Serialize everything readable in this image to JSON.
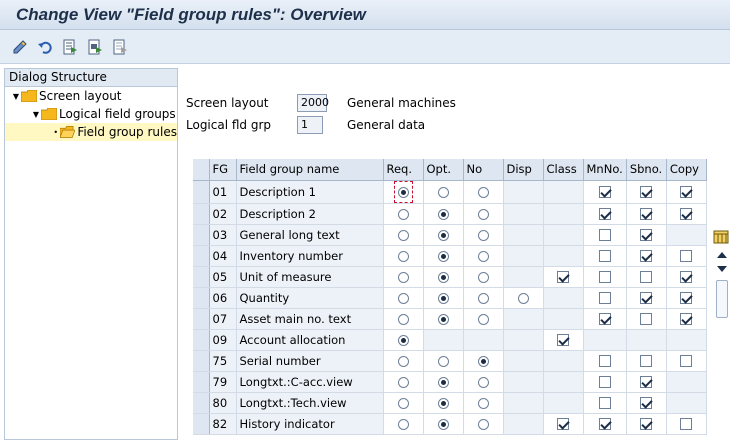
{
  "window": {
    "title": "Change View \"Field group rules\": Overview"
  },
  "toolbar": {
    "buttons": [
      {
        "name": "display-change-icon"
      },
      {
        "name": "undo-icon"
      },
      {
        "name": "select-all-icon"
      },
      {
        "name": "select-block-icon"
      },
      {
        "name": "deselect-all-icon"
      }
    ]
  },
  "dialog_structure": {
    "header": "Dialog Structure",
    "items": [
      {
        "label": "Screen layout",
        "level": 0
      },
      {
        "label": "Logical field groups",
        "level": 1
      },
      {
        "label": "Field group rules",
        "level": 2,
        "selected": true
      }
    ]
  },
  "header_fields": {
    "screen_layout": {
      "label": "Screen layout",
      "value": "2000",
      "desc": "General machines"
    },
    "logical_fld_grp": {
      "label": "Logical fld grp",
      "value": "1",
      "desc": "General data"
    }
  },
  "table": {
    "columns": [
      "FG",
      "Field group name",
      "Req.",
      "Opt.",
      "No",
      "Disp",
      "Class",
      "MnNo.",
      "Sbno.",
      "Copy"
    ],
    "rows": [
      {
        "fg": "01",
        "name": "Description 1",
        "radio": "req",
        "radios": [
          "req",
          "opt",
          "no"
        ],
        "class": null,
        "mnno": true,
        "sbno": true,
        "copy": true,
        "focus": true
      },
      {
        "fg": "02",
        "name": "Description 2",
        "radio": "opt",
        "radios": [
          "req",
          "opt",
          "no"
        ],
        "class": null,
        "mnno": true,
        "sbno": true,
        "copy": true
      },
      {
        "fg": "03",
        "name": "General long text",
        "radio": "opt",
        "radios": [
          "req",
          "opt",
          "no"
        ],
        "class": null,
        "mnno": false,
        "sbno": true,
        "copy": null
      },
      {
        "fg": "04",
        "name": "Inventory number",
        "radio": "opt",
        "radios": [
          "req",
          "opt",
          "no"
        ],
        "class": null,
        "mnno": false,
        "sbno": true,
        "copy": false
      },
      {
        "fg": "05",
        "name": "Unit of measure",
        "radio": "opt",
        "radios": [
          "req",
          "opt",
          "no"
        ],
        "class": true,
        "mnno": false,
        "sbno": false,
        "copy": true
      },
      {
        "fg": "06",
        "name": "Quantity",
        "radio": "opt",
        "radios": [
          "req",
          "opt",
          "no",
          "disp"
        ],
        "class": null,
        "mnno": false,
        "sbno": true,
        "copy": true
      },
      {
        "fg": "07",
        "name": "Asset main no. text",
        "radio": "opt",
        "radios": [
          "req",
          "opt",
          "no"
        ],
        "class": null,
        "mnno": true,
        "sbno": false,
        "copy": true
      },
      {
        "fg": "09",
        "name": "Account allocation",
        "radio": "req",
        "radios": [
          "req"
        ],
        "class": true,
        "mnno": null,
        "sbno": null,
        "copy": null
      },
      {
        "fg": "75",
        "name": "Serial number",
        "radio": "no",
        "radios": [
          "req",
          "opt",
          "no"
        ],
        "class": null,
        "mnno": false,
        "sbno": false,
        "copy": false
      },
      {
        "fg": "79",
        "name": "Longtxt.:C-acc.view",
        "radio": "opt",
        "radios": [
          "req",
          "opt",
          "no"
        ],
        "class": null,
        "mnno": false,
        "sbno": true,
        "copy": null
      },
      {
        "fg": "80",
        "name": "Longtxt.:Tech.view",
        "radio": "opt",
        "radios": [
          "req",
          "opt",
          "no"
        ],
        "class": null,
        "mnno": false,
        "sbno": true,
        "copy": null
      },
      {
        "fg": "82",
        "name": "History indicator",
        "radio": "opt",
        "radios": [
          "req",
          "opt",
          "no"
        ],
        "class": true,
        "mnno": true,
        "sbno": true,
        "copy": false
      }
    ]
  },
  "colors": {
    "title": "#1d2f49",
    "selected_tree": "#fff8c2",
    "header_bg": "#dde6f1",
    "folder": "#f5b71c"
  }
}
